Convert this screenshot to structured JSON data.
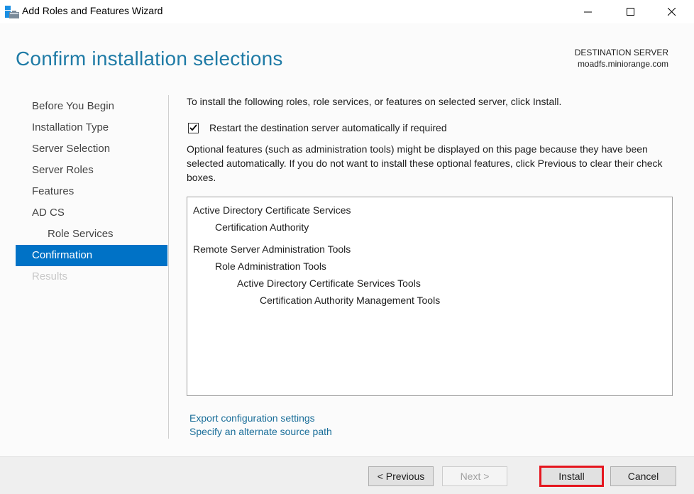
{
  "window": {
    "title": "Add Roles and Features Wizard",
    "controls": [
      "minimize",
      "maximize",
      "close"
    ]
  },
  "header": {
    "page_title": "Confirm installation selections",
    "destination_label": "DESTINATION SERVER",
    "destination_server": "moadfs.miniorange.com"
  },
  "nav": {
    "items": [
      {
        "label": "Before You Begin",
        "state": "normal"
      },
      {
        "label": "Installation Type",
        "state": "normal"
      },
      {
        "label": "Server Selection",
        "state": "normal"
      },
      {
        "label": "Server Roles",
        "state": "normal"
      },
      {
        "label": "Features",
        "state": "normal"
      },
      {
        "label": "AD CS",
        "state": "normal"
      },
      {
        "label": "Role Services",
        "state": "sub"
      },
      {
        "label": "Confirmation",
        "state": "active"
      },
      {
        "label": "Results",
        "state": "disabled"
      }
    ]
  },
  "main": {
    "intro": "To install the following roles, role services, or features on selected server, click Install.",
    "restart_checkbox": {
      "label": "Restart the destination server automatically if required",
      "checked": true
    },
    "optional_text": "Optional features (such as administration tools) might be displayed on this page because they have been selected automatically. If you do not want to install these optional features, click Previous to clear their check boxes.",
    "selections": [
      {
        "label": "Active Directory Certificate Services",
        "level": 0
      },
      {
        "label": "Certification Authority",
        "level": 1
      },
      {
        "label": "Remote Server Administration Tools",
        "level": 0
      },
      {
        "label": "Role Administration Tools",
        "level": 1
      },
      {
        "label": "Active Directory Certificate Services Tools",
        "level": 2
      },
      {
        "label": "Certification Authority Management Tools",
        "level": 3
      }
    ],
    "links": {
      "export": "Export configuration settings",
      "alternate_source": "Specify an alternate source path"
    }
  },
  "footer": {
    "previous": "< Previous",
    "next": "Next >",
    "install": "Install",
    "cancel": "Cancel",
    "highlight_color": "#e5161f"
  },
  "colors": {
    "accent": "#0072c6",
    "title": "#1f7ba6",
    "link": "#1a6e99"
  }
}
